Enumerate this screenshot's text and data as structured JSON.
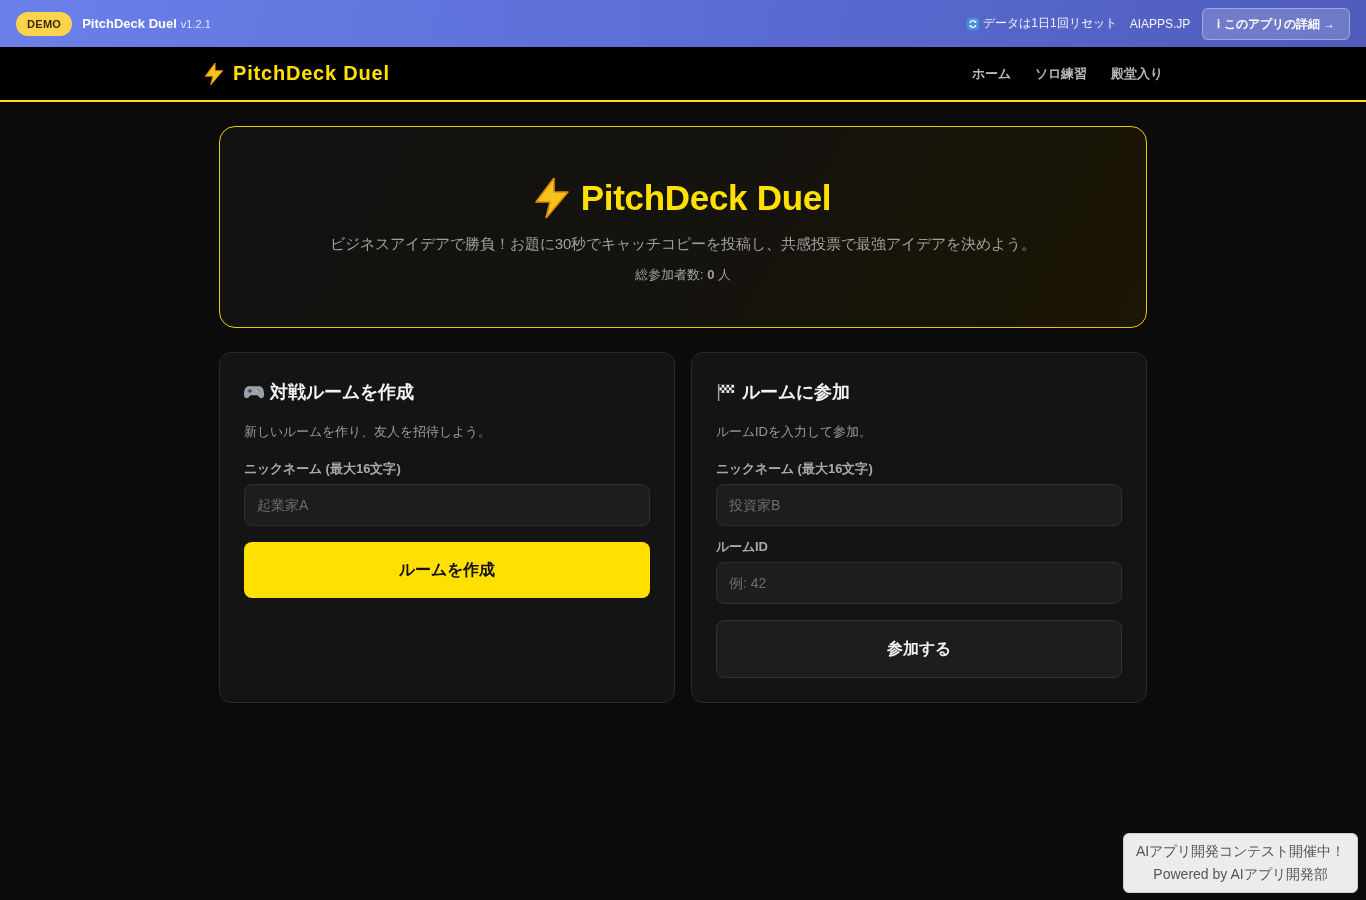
{
  "demo_bar": {
    "badge": "DEMO",
    "app_name": "PitchDeck Duel",
    "version": "v1.2.1",
    "reset_note": "データは1日1回リセット",
    "site_link": "AIAPPS.JP",
    "details_button": "ℹ このアプリの詳細 →"
  },
  "navbar": {
    "logo": "PitchDeck Duel",
    "links": [
      "ホーム",
      "ソロ練習",
      "殿堂入り"
    ]
  },
  "hero": {
    "title": "PitchDeck Duel",
    "tagline": "ビジネスアイデアで勝負！お題に30秒でキャッチコピーを投稿し、共感投票で最強アイデアを決めよう。",
    "participants": "総参加者数: **0** 人"
  },
  "cards": [
    {
      "kind": "create",
      "title": "対戦ルームを作成",
      "description": "新しいルームを作り、友人を招待しよう。",
      "fields": [
        {
          "label": "ニックネーム (最大16文字)",
          "placeholder": "起業家A"
        }
      ],
      "button": {
        "kind": "primary",
        "label": "ルームを作成"
      }
    },
    {
      "kind": "join",
      "title": "ルームに参加",
      "description": "ルームIDを入力して参加。",
      "fields": [
        {
          "label": "ニックネーム (最大16文字)",
          "placeholder": "投資家B"
        },
        {
          "label": "ルームID",
          "placeholder": "例: 42"
        }
      ],
      "button": {
        "kind": "secondary",
        "label": "参加する"
      }
    }
  ],
  "contest_notice": [
    "AIアプリ開発コンテスト開催中！",
    "Powered by AIアプリ開発部"
  ]
}
